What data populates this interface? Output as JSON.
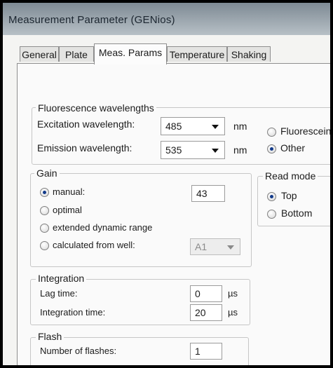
{
  "window": {
    "title": "Measurement Parameter (GENios)"
  },
  "tabs": [
    {
      "label": "General"
    },
    {
      "label": "Plate"
    },
    {
      "label": "Meas. Params"
    },
    {
      "label": "Temperature"
    },
    {
      "label": "Shaking"
    }
  ],
  "fluorescence": {
    "title": "Fluorescence wavelengths",
    "excitation_label": "Excitation wavelength:",
    "excitation_value": "485",
    "emission_label": "Emission wavelength:",
    "emission_value": "535",
    "unit": "nm",
    "options": [
      {
        "label": "Fluorescein",
        "checked": false
      },
      {
        "label": "Other",
        "checked": true
      }
    ]
  },
  "gain": {
    "title": "Gain",
    "options": [
      {
        "label": "manual:",
        "checked": true
      },
      {
        "label": "optimal",
        "checked": false
      },
      {
        "label": "extended dynamic range",
        "checked": false
      },
      {
        "label": "calculated from well:",
        "checked": false
      }
    ],
    "manual_value": "43",
    "well_value": "A1"
  },
  "read_mode": {
    "title": "Read mode",
    "options": [
      {
        "label": "Top",
        "checked": true
      },
      {
        "label": "Bottom",
        "checked": false
      }
    ]
  },
  "integration": {
    "title": "Integration",
    "lag_label": "Lag time:",
    "lag_value": "0",
    "time_label": "Integration time:",
    "time_value": "20",
    "unit": "µs"
  },
  "flash": {
    "title": "Flash",
    "flashes_label": "Number of flashes:",
    "flashes_value": "1"
  }
}
